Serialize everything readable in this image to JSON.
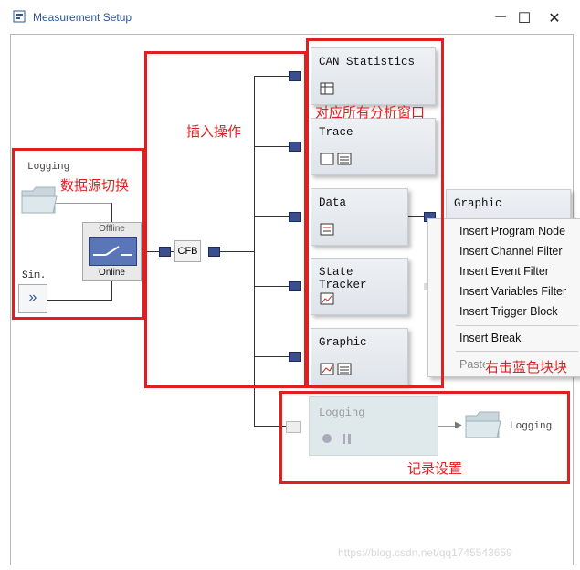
{
  "window": {
    "title": "Measurement Setup",
    "minimize": "─",
    "maximize": "☐",
    "close": "✕"
  },
  "blocks": {
    "logging_source": "Logging",
    "sim": "Sim.",
    "sim_button": "»",
    "offline": "Offline",
    "online": "Online",
    "cfb": "CFB",
    "can_statistics": "CAN Statistics",
    "trace": "Trace",
    "data": "Data",
    "state_tracker": "State Tracker",
    "graphic": "Graphic",
    "graphic_popup": "Graphic",
    "logging_block": "Logging",
    "logging_out": "Logging"
  },
  "annotations": {
    "source_switch": "数据源切换",
    "insert_op": "插入操作",
    "windows": "对应所有分析窗口",
    "right_click": "右击蓝色块块",
    "log_settings": "记录设置"
  },
  "menu": {
    "items": [
      "Insert Program Node",
      "Insert Channel Filter",
      "Insert Event Filter",
      "Insert Variables Filter",
      "Insert Trigger Block"
    ],
    "break": "Insert Break",
    "paste": "Paste"
  },
  "watermark": "https://blog.csdn.net/qq1745543659",
  "colors": {
    "annotation": "#e02020",
    "port": "#3b4f8f",
    "title": "#2b5797"
  }
}
